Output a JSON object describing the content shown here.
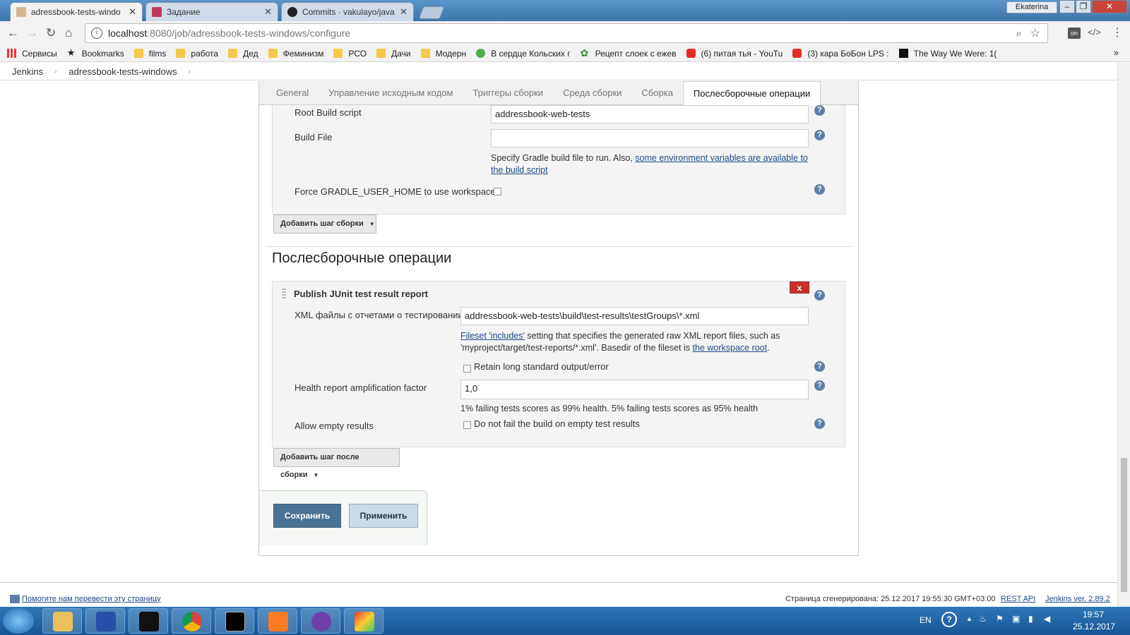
{
  "browser": {
    "tabs": [
      {
        "title": "adressbook-tests-windo",
        "active": true,
        "icon": "jenkins-icon"
      },
      {
        "title": "Задание",
        "active": false,
        "icon": "m-logo-icon"
      },
      {
        "title": "Commits · vakulayo/java",
        "active": false,
        "icon": "github-icon"
      }
    ],
    "user": "Ekaterina",
    "url_host": "localhost",
    "url_rest": ":8080/job/adressbook-tests-windows/configure",
    "bookmarks": [
      {
        "label": "Сервисы",
        "icon": "apps-icon"
      },
      {
        "label": "Bookmarks",
        "icon": "star-icon"
      },
      {
        "label": "films",
        "icon": "folder-icon"
      },
      {
        "label": "работа",
        "icon": "folder-icon"
      },
      {
        "label": "Дед",
        "icon": "folder-icon"
      },
      {
        "label": "Феминизм",
        "icon": "folder-icon"
      },
      {
        "label": "РСО",
        "icon": "folder-icon"
      },
      {
        "label": "Дачи",
        "icon": "folder-icon"
      },
      {
        "label": "Модерн",
        "icon": "folder-icon"
      },
      {
        "label": "В сердце Кольских г",
        "icon": "kp-icon"
      },
      {
        "label": "Рецепт слоек с ежев",
        "icon": "gear-green-icon"
      },
      {
        "label": "(6) питая тья - YouTu",
        "icon": "youtube-icon"
      },
      {
        "label": "(3) кара БоБон LPS :",
        "icon": "youtube-icon"
      },
      {
        "label": "The Way We Were: 1(",
        "icon": "psy-icon"
      }
    ]
  },
  "breadcrumb": [
    "Jenkins",
    "adressbook-tests-windows"
  ],
  "config_tabs": [
    "General",
    "Управление исходным кодом",
    "Триггеры сборки",
    "Среда сборки",
    "Сборка",
    "Послесборочные операции"
  ],
  "build": {
    "root_build_script_label": "Root Build script",
    "root_build_script_value": "addressbook-web-tests",
    "build_file_label": "Build File",
    "build_file_value": "",
    "build_file_hint_prefix": "Specify Gradle build file to run. Also,",
    "build_file_hint_link": "some environment variables are available to the build script",
    "force_gradle_label": "Force GRADLE_USER_HOME to use workspace",
    "add_step_button": "Добавить шаг сборки"
  },
  "post": {
    "heading": "Послесборочные операции",
    "publisher_title": "Publish JUnit test result report",
    "delete_label": "x",
    "xml_label": "XML файлы с отчетами о тестировании",
    "xml_value": "addressbook-web-tests\\build\\test-results\\testGroups\\*.xml",
    "xml_hint_link": "Fileset 'includes'",
    "xml_hint_text1": " setting that specifies the generated raw XML report files, such as",
    "xml_hint_text2": "'myproject/target/test-reports/*.xml'. Basedir of the fileset is ",
    "xml_hint_link2": "the workspace root",
    "xml_hint_end": ".",
    "retain_label": "Retain long standard output/error",
    "health_label": "Health report amplification factor",
    "health_value": "1,0",
    "health_hint": "1% failing tests scores as 99% health. 5% failing tests scores as 95% health",
    "allow_empty_label": "Allow empty results",
    "allow_empty_cb": "Do not fail the build on empty test results",
    "add_post_button": "Добавить шаг после сборки"
  },
  "actions": {
    "save": "Сохранить",
    "apply": "Применить"
  },
  "footer": {
    "translate_link": "Помогите нам перевести эту страницу",
    "generated": "Страница сгенерирована: 25.12.2017 19:55:30 GMT+03:00",
    "rest_api": "REST API",
    "version": "Jenkins ver. 2.89.2"
  },
  "taskbar": {
    "lang": "EN",
    "time": "19:57",
    "date": "25.12.2017",
    "apps": [
      "explorer-icon",
      "floppy-icon",
      "intellij-icon",
      "chrome-icon",
      "cmd-icon",
      "xampp-icon",
      "github-desktop-icon",
      "paint-icon"
    ]
  },
  "colors": {
    "accent": "#4a7294",
    "help": "#5d7fa6",
    "delete": "#c9302c"
  }
}
